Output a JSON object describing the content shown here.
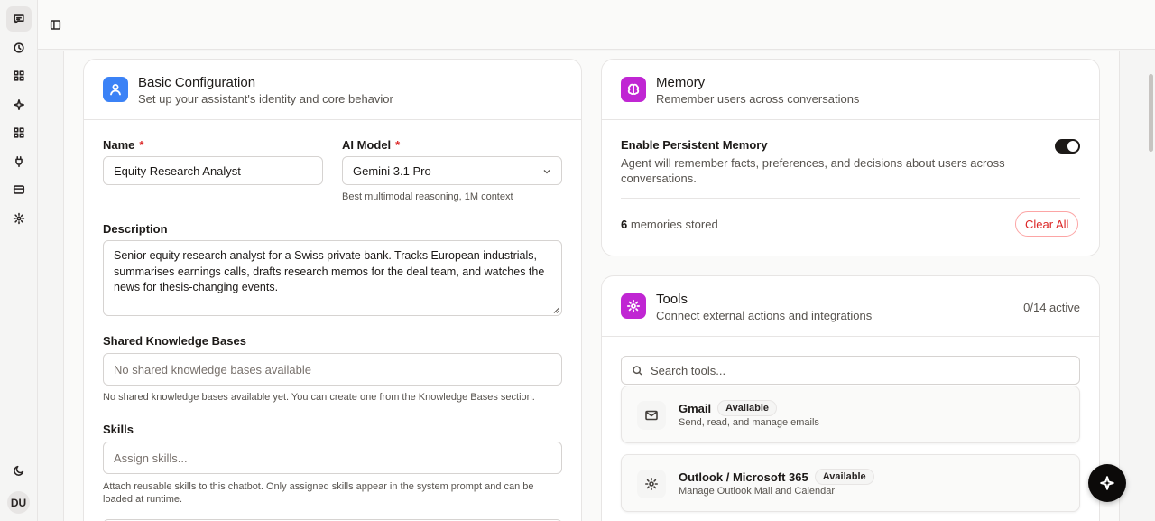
{
  "rail": {
    "icons": [
      "chat-icon",
      "history-icon",
      "apps-icon",
      "sparkle-icon",
      "grid-icon",
      "plug-icon",
      "card-icon",
      "settings-icon"
    ],
    "theme_icon": "moon-icon",
    "avatar": "DU"
  },
  "topbar": {
    "toggle_icon": "sidebar-toggle-icon"
  },
  "basic": {
    "title": "Basic Configuration",
    "subtitle": "Set up your assistant's identity and core behavior",
    "icon_color": "#3b82f6",
    "name_label": "Name",
    "required_mark": "*",
    "name_value": "Equity Research Analyst",
    "model_label": "AI Model",
    "model_value": "Gemini 3.1 Pro",
    "model_hint": "Best multimodal reasoning, 1M context",
    "description_label": "Description",
    "description_value": "Senior equity research analyst for a Swiss private bank. Tracks European industrials, summarises earnings calls, drafts research memos for the deal team, and watches the news for thesis-changing events.",
    "kb_label": "Shared Knowledge Bases",
    "kb_placeholder": "No shared knowledge bases available",
    "kb_hint": "No shared knowledge bases available yet. You can create one from the Knowledge Bases section.",
    "skills_label": "Skills",
    "skills_placeholder": "Assign skills...",
    "skills_hint": "Attach reusable skills to this chatbot. Only assigned skills appear in the system prompt and can be loaded at runtime."
  },
  "memory": {
    "title": "Memory",
    "subtitle": "Remember users across conversations",
    "icon_color": "#c026d3",
    "toggle_label": "Enable Persistent Memory",
    "toggle_desc": "Agent will remember facts, preferences, and decisions about users across conversations.",
    "enabled": true,
    "count": "6",
    "count_suffix": "memories stored",
    "clear_label": "Clear All"
  },
  "tools": {
    "title": "Tools",
    "subtitle": "Connect external actions and integrations",
    "icon_color": "#c026d3",
    "active_count": "0/14 active",
    "search_placeholder": "Search tools...",
    "items": [
      {
        "name": "Gmail",
        "badge": "Available",
        "desc": "Send, read, and manage emails",
        "icon": "mail-icon"
      },
      {
        "name": "Outlook / Microsoft 365",
        "badge": "Available",
        "desc": "Manage Outlook Mail and Calendar",
        "icon": "gear-icon"
      }
    ]
  },
  "fab": {
    "icon": "sparkle-icon"
  }
}
